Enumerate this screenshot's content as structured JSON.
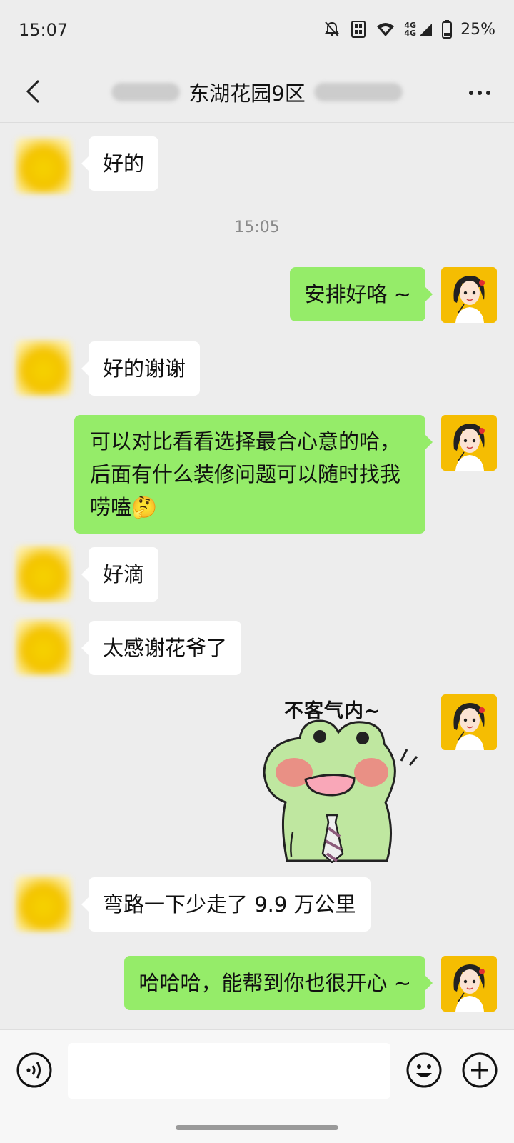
{
  "status_bar": {
    "time": "15:07",
    "network": "4G",
    "battery": "25%",
    "icons": [
      "mute-bell-icon",
      "vibrate-icon",
      "wifi-icon",
      "signal-icon",
      "battery-icon"
    ]
  },
  "header": {
    "title": "东湖花园9区",
    "back_icon": "chevron-left-icon",
    "more_icon": "ellipsis-icon"
  },
  "messages": [
    {
      "side": "in",
      "text": "好的"
    },
    {
      "type": "timestamp",
      "text": "15:05"
    },
    {
      "side": "out",
      "text": "安排好咯 ~"
    },
    {
      "side": "in",
      "text": "好的谢谢"
    },
    {
      "side": "out",
      "text": "可以对比看看选择最合心意的哈，后面有什么装修问题可以随时找我唠嗑🤔"
    },
    {
      "side": "in",
      "text": "好滴"
    },
    {
      "side": "in",
      "text": "太感谢花爷了"
    },
    {
      "side": "out",
      "type": "sticker",
      "caption": "不客气内~",
      "sticker": "frog-with-tie"
    },
    {
      "side": "in",
      "text": "弯路一下少走了 9.9 万公里"
    },
    {
      "side": "out",
      "text": "哈哈哈，能帮到你也很开心 ~"
    }
  ],
  "input_bar": {
    "placeholder": "",
    "voice_icon": "voice-icon",
    "emoji_icon": "emoji-icon",
    "plus_icon": "plus-icon"
  },
  "colors": {
    "background": "#ededed",
    "bubble_out": "#95ec69",
    "bubble_in": "#ffffff",
    "avatar_me_bg": "#f5bd02"
  }
}
